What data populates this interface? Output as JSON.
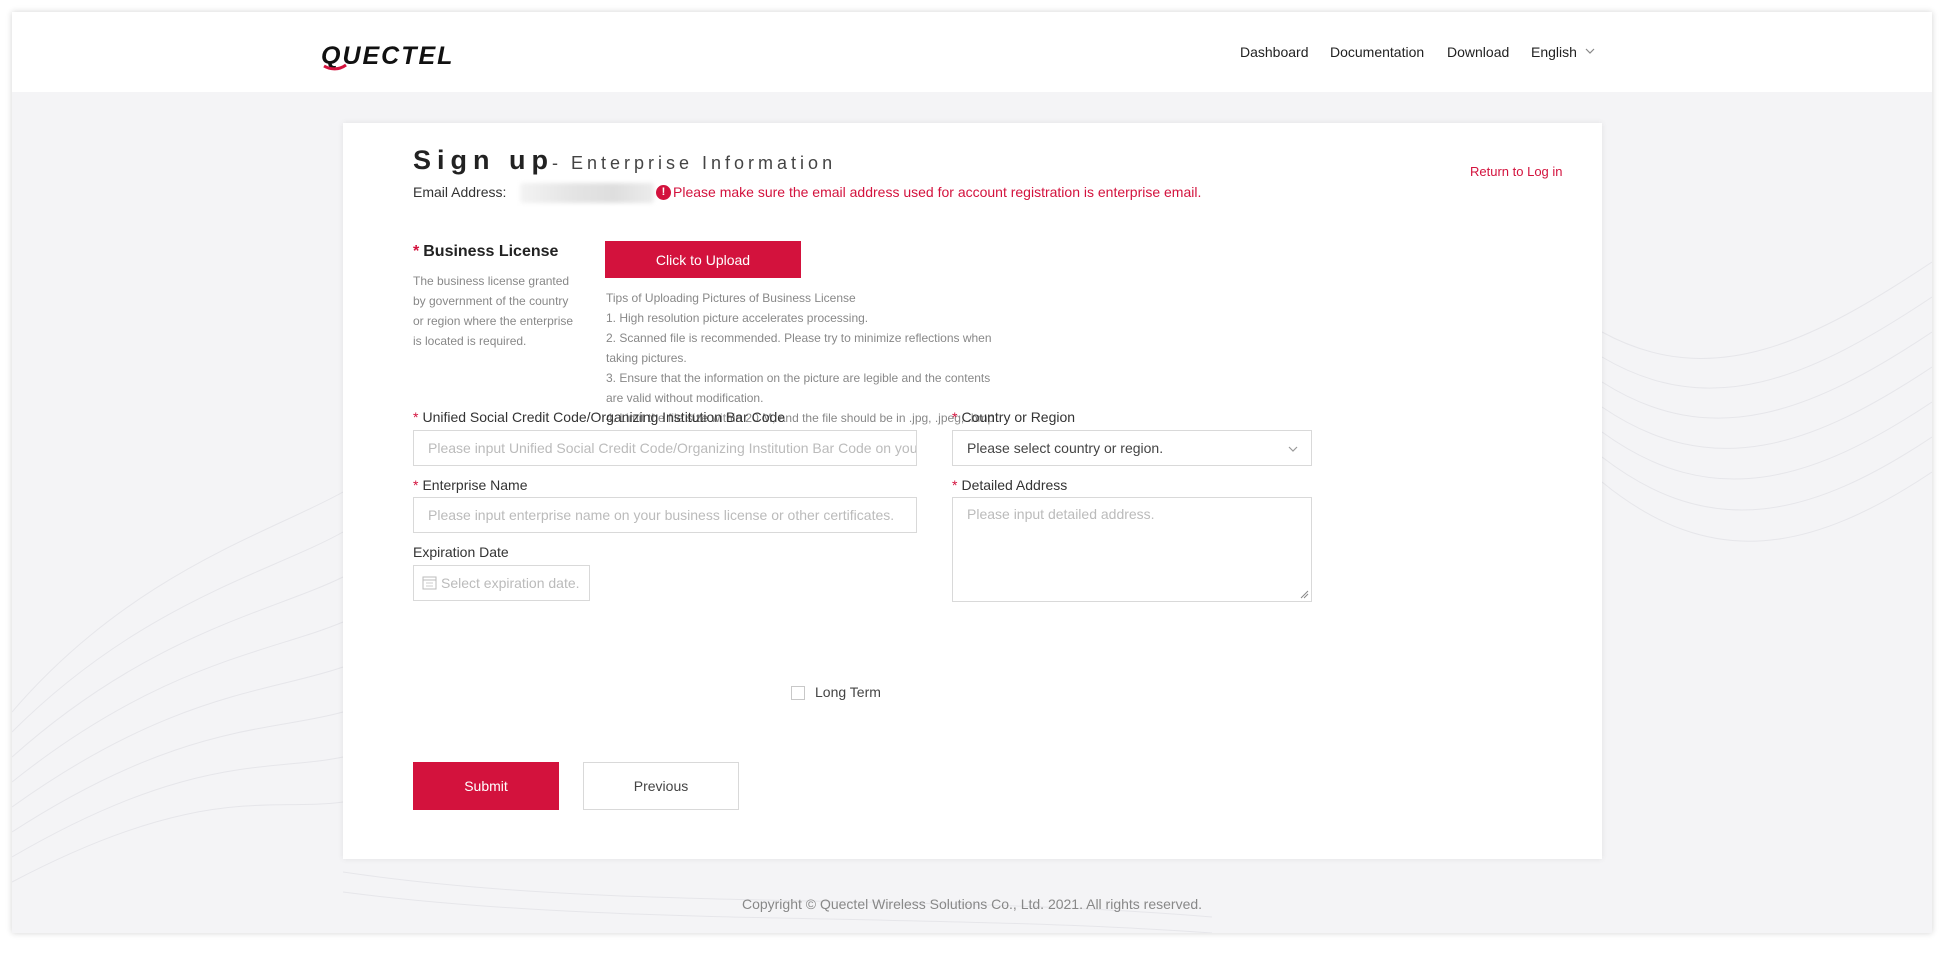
{
  "header": {
    "logo_text": "QUECTEL",
    "nav": [
      "Dashboard",
      "Documentation",
      "Download"
    ],
    "language": "English"
  },
  "form": {
    "title": "Sign up",
    "subtitle": "- Enterprise Information",
    "return_link": "Return to Log in",
    "email_label": "Email Address:",
    "email_warning": "Please make sure the email address used for account registration is enterprise email.",
    "required_mark": "*",
    "business_license": {
      "title": "Business License",
      "description": "The business license granted by government of the country or region where the enterprise is located is required.",
      "upload_button": "Click to Upload",
      "tips": [
        "Tips of Uploading Pictures of Business License",
        "1. High resolution picture accelerates processing.",
        "2. Scanned file is recommended. Please try to minimize reflections when taking pictures.",
        "3. Ensure that the information on the picture are legible and the contents are valid without modification.",
        "4. Limit the file size within 20 M, and the file should be in .jpg, .jpeg, .bmp or .png format."
      ]
    },
    "credit_code": {
      "label": "Unified Social Credit Code/Organizing Institution Bar Code",
      "placeholder": "Please input Unified Social Credit Code/Organizing Institution Bar Code on your business license."
    },
    "country": {
      "label": "Country or Region",
      "placeholder": "Please select country or region."
    },
    "enterprise_name": {
      "label": "Enterprise Name",
      "placeholder": "Please input enterprise name on your business license or other certificates."
    },
    "address": {
      "label": "Detailed Address",
      "placeholder": "Please input detailed address."
    },
    "expiration": {
      "label": "Expiration Date",
      "placeholder": "Select expiration date."
    },
    "long_term_label": "Long Term",
    "submit_label": "Submit",
    "previous_label": "Previous"
  },
  "footer": {
    "copyright": "Copyright © Quectel Wireless Solutions Co., Ltd. 2021. All rights reserved."
  },
  "colors": {
    "accent": "#d3123d",
    "background": "#f4f4f6"
  }
}
